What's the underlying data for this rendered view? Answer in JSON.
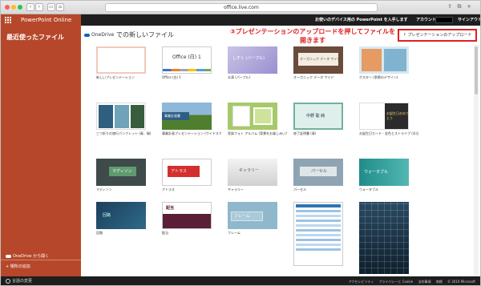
{
  "browser": {
    "url": "office.live.com",
    "nav": [
      "‹",
      "›",
      "▭",
      "⌂"
    ],
    "right_icons": [
      "⇪",
      "⧉",
      "+"
    ]
  },
  "header": {
    "app_title": "PowerPoint Online",
    "promo": "お使いのデバイス用の PowerPoint を入手します",
    "account": "アカウント",
    "sign_out": "サインアウト"
  },
  "sidebar": {
    "heading": "最近使ったファイル",
    "open_onedrive": "OneDrive から開く",
    "add_place": "場所の追加"
  },
  "main": {
    "onedrive_label": "OneDrive",
    "new_file_title": "での新しいファイル",
    "annotation": "③プレゼンテーションのアップロードを押してファイルを開きます",
    "upload_button": "プレゼンテーションのアップロード"
  },
  "templates": [
    {
      "caption": "新しいプレゼンテーション",
      "title": ""
    },
    {
      "caption": "Office (白) 1",
      "title": "Office (白) 1"
    },
    {
      "caption": "水滴 (パープル)",
      "title": "しずく (パープル)"
    },
    {
      "caption": "オーガニック データ ワイド",
      "title": "オーガニック データ ワイド"
    },
    {
      "caption": "ポスター (季節のデザイン)",
      "title": ""
    },
    {
      "caption": "三つ折りの旅行パンフレット (青、緑)",
      "title": ""
    },
    {
      "caption": "事業計画プレゼンテーション (ワイドスクリーン)",
      "title": "事業計画書"
    },
    {
      "caption": "家族フォト アルバム (背景をお楽しみいただけるデザイン)",
      "title": ""
    },
    {
      "caption": "修了証明書 (青)",
      "title": "中野 聡 純"
    },
    {
      "caption": "お誕生日カード - 金色とストライプ (半分折り)",
      "title": "お誕生日おめでとう"
    },
    {
      "caption": "マディソン",
      "title": "マディソン"
    },
    {
      "caption": "アトラス",
      "title": "アトラス"
    },
    {
      "caption": "ギャラリー",
      "title": "ギャラリー"
    },
    {
      "caption": "パーセル",
      "title": "パーセル"
    },
    {
      "caption": "ウォータブル",
      "title": "ウォータブル"
    },
    {
      "caption": "回路",
      "title": "回路"
    },
    {
      "caption": "配当",
      "title": "配当"
    },
    {
      "caption": "フレーム",
      "title": "フレーム"
    },
    {
      "caption": "",
      "title": ""
    },
    {
      "caption": "",
      "title": ""
    }
  ],
  "footer": {
    "language": "言語の変更",
    "links": [
      "アクセシビリティ",
      "プライバシーと Cookie",
      "法的事項",
      "商標",
      "© 2016 Microsoft"
    ]
  }
}
